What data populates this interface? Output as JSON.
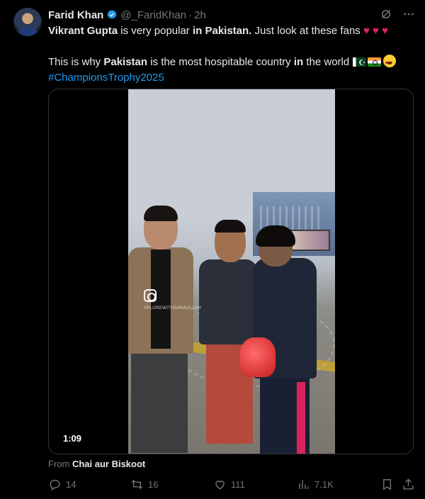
{
  "author": {
    "name": "Farid Khan",
    "handle": "@_FaridKhan",
    "separator": "·",
    "time": "2h"
  },
  "tweet": {
    "line1": {
      "part1": "Vikrant Gupta",
      "part2": " is very popular ",
      "part3": "in Pakistan.",
      "part4": " Just look at these fans "
    },
    "line2": {
      "part1": "This is why ",
      "part2": "Pakistan",
      "part3": " is the most hospitable country ",
      "part4": "in",
      "part5": " the world "
    },
    "hashtag": "#ChampionsTrophy2025"
  },
  "media": {
    "timecode": "1:09",
    "watermark": "XPLOREWITHSANAULLAH"
  },
  "source": {
    "prefix": "From ",
    "name": "Chai aur Biskoot"
  },
  "actions": {
    "replies": "14",
    "reposts": "16",
    "likes": "111",
    "views": "7.1K"
  },
  "colors": {
    "background": "#000000",
    "text": "#e7e9ea",
    "muted": "#71767b",
    "link": "#1d9bf0",
    "verified": "#1d9bf0",
    "heart": "#e0245e"
  },
  "icons": [
    "verified-badge-icon",
    "grok-icon",
    "more-icon",
    "heart-emoji",
    "pakistan-flag-emoji",
    "india-flag-emoji",
    "star-struck-emoji",
    "instagram-icon",
    "reply-icon",
    "repost-icon",
    "like-icon",
    "views-icon",
    "bookmark-icon",
    "share-icon"
  ]
}
